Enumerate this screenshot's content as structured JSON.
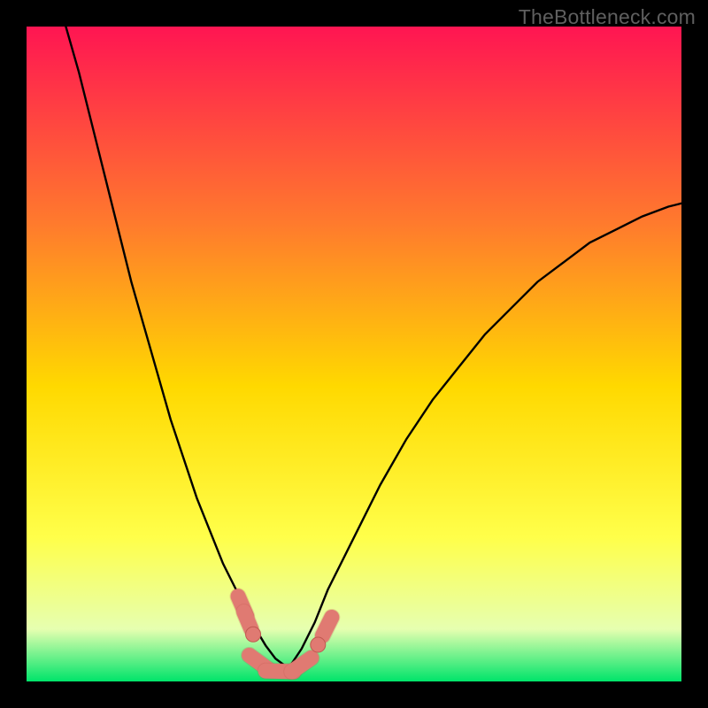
{
  "watermark": "TheBottleneck.com",
  "colors": {
    "frame": "#000000",
    "gradient_top": "#ff1552",
    "gradient_mid1": "#ff7a2d",
    "gradient_mid2": "#ffd900",
    "gradient_mid3": "#ffff4a",
    "gradient_bottom1": "#e6ffb0",
    "gradient_bottom2": "#00e46a",
    "curve": "#000000",
    "marker_fill": "#e07a72",
    "marker_stroke": "#c05850"
  },
  "chart_data": {
    "type": "line",
    "title": "",
    "xlabel": "",
    "ylabel": "",
    "x_range": [
      0,
      100
    ],
    "y_range": [
      0,
      100
    ],
    "note": "Axes are not labeled; values are estimated relative to the plot area (0-100) from the rendered pixels.",
    "series": [
      {
        "name": "curve1",
        "x": [
          6,
          8,
          10,
          12,
          14,
          16,
          18,
          20,
          22,
          24,
          26,
          28,
          30,
          32,
          34,
          35,
          36.5,
          38,
          40
        ],
        "y": [
          100,
          93,
          85,
          77,
          69,
          61,
          54,
          47,
          40,
          34,
          28,
          23,
          18,
          14,
          10,
          8,
          5.5,
          3.5,
          2
        ]
      },
      {
        "name": "curve2",
        "x": [
          40,
          42,
          44,
          46,
          48,
          50,
          54,
          58,
          62,
          66,
          70,
          74,
          78,
          82,
          86,
          90,
          94,
          98,
          100
        ],
        "y": [
          2,
          5,
          9,
          14,
          18,
          22,
          30,
          37,
          43,
          48,
          53,
          57,
          61,
          64,
          67,
          69,
          71,
          72.5,
          73
        ]
      }
    ],
    "markers": [
      {
        "kind": "segment",
        "x1": 32.3,
        "y1": 13.0,
        "x2": 33.6,
        "y2": 10.0
      },
      {
        "kind": "segment",
        "x1": 33.2,
        "y1": 10.6,
        "x2": 34.3,
        "y2": 8.0
      },
      {
        "kind": "segment",
        "x1": 34.0,
        "y1": 4.0,
        "x2": 37.0,
        "y2": 1.8
      },
      {
        "kind": "segment",
        "x1": 36.5,
        "y1": 1.6,
        "x2": 40.8,
        "y2": 1.5
      },
      {
        "kind": "segment",
        "x1": 40.5,
        "y1": 1.5,
        "x2": 43.5,
        "y2": 3.6
      },
      {
        "kind": "segment",
        "x1": 45.2,
        "y1": 7.0,
        "x2": 46.6,
        "y2": 9.8
      },
      {
        "kind": "dot",
        "x": 34.6,
        "y": 7.2
      },
      {
        "kind": "dot",
        "x": 44.5,
        "y": 5.6
      }
    ]
  }
}
